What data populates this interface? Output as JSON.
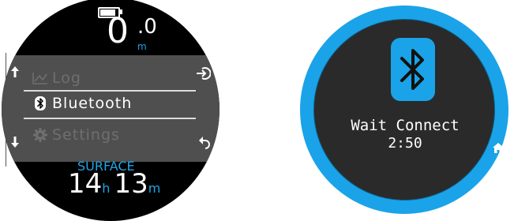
{
  "left_watch": {
    "battery_level": 0.8,
    "depth_value": "0",
    "depth_decimal": ".0",
    "depth_unit": "m",
    "menu": {
      "items": [
        {
          "label": "Log",
          "icon": "log-chart-icon",
          "state": "dim"
        },
        {
          "label": "Bluetooth",
          "icon": "bluetooth-icon",
          "state": "selected"
        },
        {
          "label": "Settings",
          "icon": "gear-icon",
          "state": "dim"
        }
      ],
      "enter_icon": "enter-icon",
      "back_icon": "back-arrow-icon",
      "scroll_up_icon": "arrow-up-icon",
      "scroll_down_icon": "arrow-down-icon"
    },
    "status_label": "SURFACE",
    "surface_hours": "14",
    "hours_unit": "h",
    "surface_minutes": "13",
    "minutes_unit": "m"
  },
  "right_watch": {
    "icon": "bluetooth-icon",
    "message": "Wait Connect",
    "countdown": "2:50",
    "home_icon": "home-icon"
  },
  "colors": {
    "accent_blue": "#1aa3e8",
    "screen_black": "#000000",
    "menu_panel": "#4f4f4f",
    "dim_text": "#6f6f6f",
    "inner_dark": "#2a2a2a"
  }
}
